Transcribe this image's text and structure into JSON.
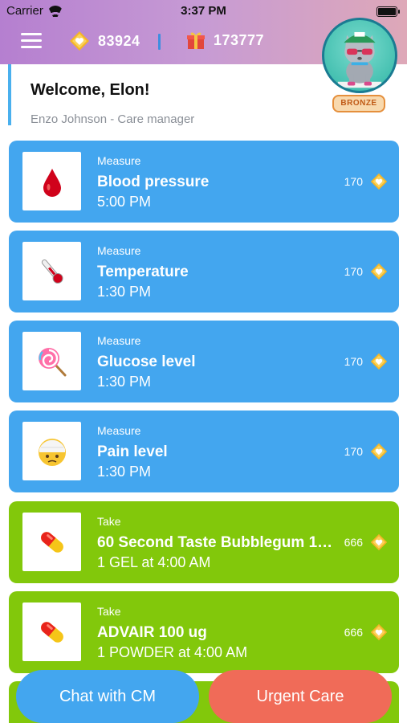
{
  "status_bar": {
    "carrier": "Carrier",
    "time": "3:37 PM"
  },
  "header": {
    "coins": "83924",
    "gifts": "173777",
    "rank_badge": "BRONZE"
  },
  "welcome": {
    "title": "Welcome, Elon!",
    "subtitle": "Enzo Johnson - Care manager"
  },
  "tasks": [
    {
      "type": "Measure",
      "title": "Blood pressure",
      "time": "5:00 PM",
      "points": "170",
      "icon": "blood-drop-icon",
      "color": "#43a6ef"
    },
    {
      "type": "Measure",
      "title": "Temperature",
      "time": "1:30 PM",
      "points": "170",
      "icon": "thermometer-icon",
      "color": "#43a6ef"
    },
    {
      "type": "Measure",
      "title": "Glucose level",
      "time": "1:30 PM",
      "points": "170",
      "icon": "lollipop-icon",
      "color": "#43a6ef"
    },
    {
      "type": "Measure",
      "title": "Pain level",
      "time": "1:30 PM",
      "points": "170",
      "icon": "bandaged-face-icon",
      "color": "#43a6ef"
    },
    {
      "type": "Take",
      "title": "60 Second Taste Bubblegum 1…",
      "time": "1 GEL at 4:00 AM",
      "points": "666",
      "icon": "pill-icon",
      "color": "#82c80b"
    },
    {
      "type": "Take",
      "title": "ADVAIR 100 ug",
      "time": "1 POWDER at 4:00 AM",
      "points": "666",
      "icon": "pill-icon",
      "color": "#82c80b"
    }
  ],
  "buttons": {
    "chat": "Chat with CM",
    "urgent": "Urgent Care"
  },
  "colors": {
    "measure": "#43a6ef",
    "take": "#82c80b",
    "urgent": "#f06b58",
    "accent_gold": "#f5b627"
  }
}
